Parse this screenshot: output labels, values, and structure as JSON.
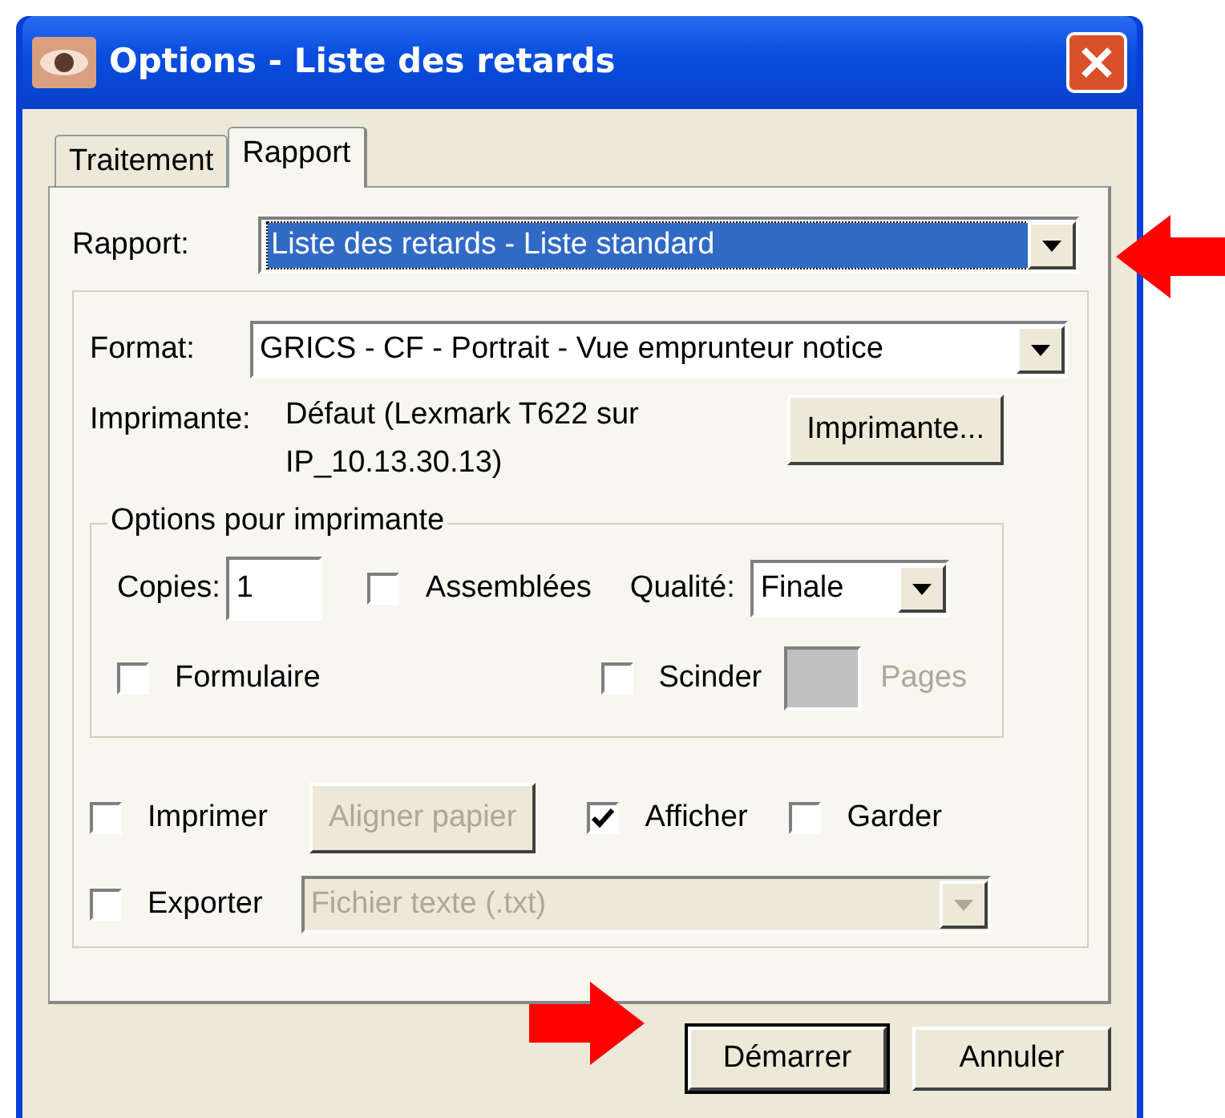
{
  "window": {
    "title": "Options - Liste des retards"
  },
  "tabs": [
    {
      "label": "Traitement",
      "selected": false
    },
    {
      "label": "Rapport",
      "selected": true
    }
  ],
  "report": {
    "label": "Rapport:",
    "value": "Liste des retards - Liste standard",
    "highlighted": true
  },
  "format": {
    "label": "Format:",
    "value": "GRICS - CF - Portrait - Vue emprunteur notice"
  },
  "printer": {
    "label": "Imprimante:",
    "value": "Défaut (Lexmark T622 sur IP_10.13.30.13)",
    "button": "Imprimante..."
  },
  "printer_options": {
    "title": "Options pour imprimante",
    "copies_label": "Copies:",
    "copies": "1",
    "collate": {
      "label": "Assemblées",
      "checked": false
    },
    "quality_label": "Qualité:",
    "quality": "Finale",
    "form": {
      "label": "Formulaire",
      "checked": false
    },
    "split": {
      "label": "Scinder",
      "checked": false
    },
    "pages_label": "Pages",
    "pages_disabled": true
  },
  "print": {
    "label": "Imprimer",
    "checked": false
  },
  "align_button": {
    "label": "Aligner papier",
    "disabled": true
  },
  "display": {
    "label": "Afficher",
    "checked": true
  },
  "keep": {
    "label": "Garder",
    "checked": false
  },
  "export": {
    "label": "Exporter",
    "checked": false,
    "value": "Fichier texte (.txt)",
    "disabled": true
  },
  "buttons": [
    {
      "label": "Démarrer",
      "default": true
    },
    {
      "label": "Annuler",
      "default": false
    }
  ]
}
